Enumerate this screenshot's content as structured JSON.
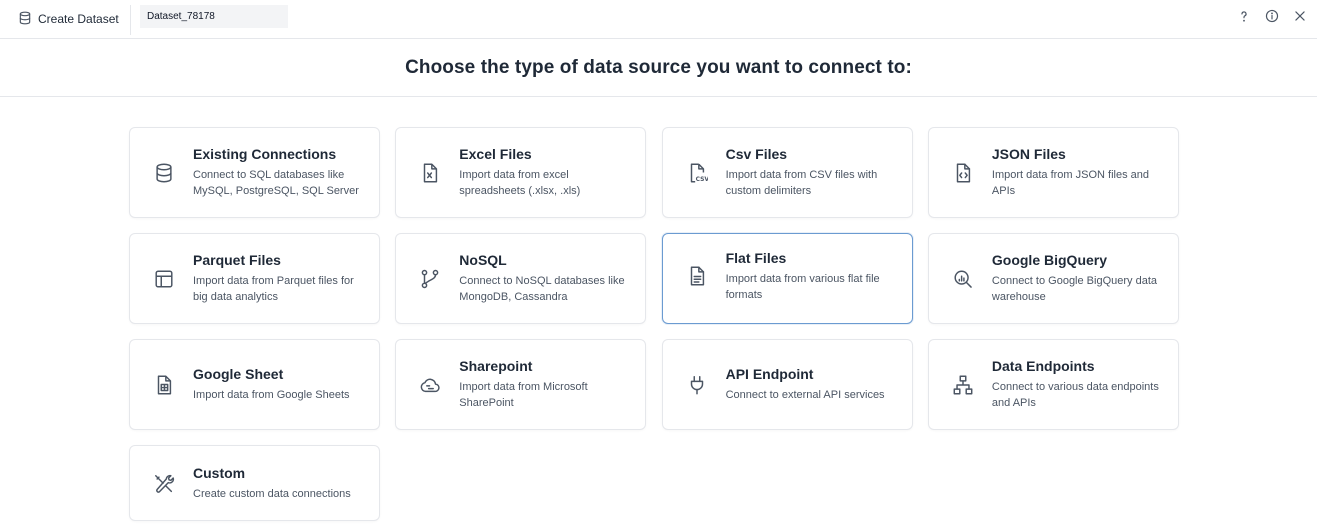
{
  "topbar": {
    "title": "Create Dataset",
    "title_icon": "database-icon",
    "dataset_name": "Dataset_78178",
    "actions": [
      {
        "name": "help-button",
        "icon": "question-icon"
      },
      {
        "name": "info-button",
        "icon": "info-icon"
      },
      {
        "name": "close-button",
        "icon": "close-icon"
      }
    ]
  },
  "header": {
    "title": "Choose the type of data source you want to connect to:"
  },
  "sources": [
    {
      "id": "existing-connections",
      "icon": "database-icon",
      "title": "Existing Connections",
      "desc": "Connect to SQL databases like MySQL, PostgreSQL, SQL Server"
    },
    {
      "id": "excel-files",
      "icon": "excel-file-icon",
      "title": "Excel Files",
      "desc": "Import data from excel spreadsheets (.xlsx, .xls)"
    },
    {
      "id": "csv-files",
      "icon": "csv-file-icon",
      "title": "Csv Files",
      "desc": "Import data from CSV files with custom delimiters"
    },
    {
      "id": "json-files",
      "icon": "json-file-icon",
      "title": "JSON Files",
      "desc": "Import data from JSON files and APIs"
    },
    {
      "id": "parquet-files",
      "icon": "layout-icon",
      "title": "Parquet Files",
      "desc": "Import data from Parquet files for big data analytics"
    },
    {
      "id": "nosql",
      "icon": "git-branch-icon",
      "title": "NoSQL",
      "desc": "Connect to NoSQL databases like MongoDB, Cassandra"
    },
    {
      "id": "flat-files",
      "icon": "text-file-icon",
      "title": "Flat Files",
      "desc": "Import data from various flat file formats",
      "selected": true
    },
    {
      "id": "google-bigquery",
      "icon": "search-chart-icon",
      "title": "Google BigQuery",
      "desc": "Connect to Google BigQuery data warehouse"
    },
    {
      "id": "google-sheet",
      "icon": "sheet-file-icon",
      "title": "Google Sheet",
      "desc": "Import data from Google Sheets"
    },
    {
      "id": "sharepoint",
      "icon": "cloud-icon",
      "title": "Sharepoint",
      "desc": "Import data from Microsoft SharePoint"
    },
    {
      "id": "api-endpoint",
      "icon": "plug-icon",
      "title": "API Endpoint",
      "desc": "Connect to external API services"
    },
    {
      "id": "data-endpoints",
      "icon": "network-icon",
      "title": "Data Endpoints",
      "desc": "Connect to various data endpoints and APIs"
    },
    {
      "id": "custom",
      "icon": "tools-icon",
      "title": "Custom",
      "desc": "Create custom data connections"
    }
  ],
  "colors": {
    "border": "#e5e7eb",
    "selected_border": "#6b9bd1",
    "text": "#1f2937",
    "muted": "#4b5563"
  }
}
